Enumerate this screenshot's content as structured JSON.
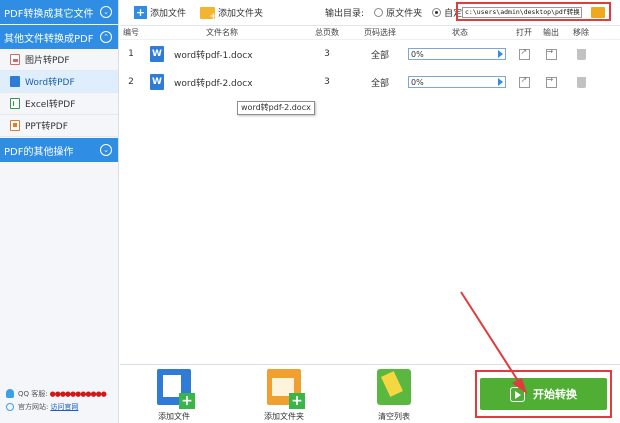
{
  "sidebar": {
    "categories": [
      {
        "label": "PDF转换成其它文件"
      },
      {
        "label": "其他文件转换成PDF"
      },
      {
        "label": "PDF的其他操作"
      }
    ],
    "items": [
      {
        "label": "图片转PDF",
        "icon": "image-file-icon"
      },
      {
        "label": "Word转PDF",
        "icon": "word-file-icon",
        "active": true
      },
      {
        "label": "Excel转PDF",
        "icon": "excel-file-icon"
      },
      {
        "label": "PPT转PDF",
        "icon": "ppt-file-icon"
      }
    ],
    "contact": {
      "qq_label": "QQ 客服:",
      "qq_value": "●●●●●●●●●●●",
      "site_label": "官方网站:",
      "site_link": "访问官网"
    }
  },
  "toolbar": {
    "add_file": "添加文件",
    "add_folder": "添加文件夹",
    "output_label": "输出目录:",
    "radio_original": "原文件夹",
    "radio_custom": "自定义",
    "path_value": "c:\\users\\admin\\desktop\\pdf转换"
  },
  "table": {
    "headers": {
      "no": "编号",
      "name": "文件名称",
      "pages": "总页数",
      "range": "页码选择",
      "status": "状态",
      "open": "打开",
      "output": "输出",
      "remove": "移除"
    },
    "rows": [
      {
        "no": "1",
        "name": "word转pdf-1.docx",
        "pages": "3",
        "range": "全部",
        "status": "0%"
      },
      {
        "no": "2",
        "name": "word转pdf-2.docx",
        "pages": "3",
        "range": "全部",
        "status": "0%"
      }
    ],
    "tooltip": "word转pdf-2.docx"
  },
  "bottom": {
    "add_file": "添加文件",
    "add_folder": "添加文件夹",
    "clear_list": "清空列表",
    "start": "开始转换"
  },
  "colors": {
    "accent": "#2f8de4",
    "start_green": "#4fae33",
    "highlight_red": "#e23b3b"
  }
}
